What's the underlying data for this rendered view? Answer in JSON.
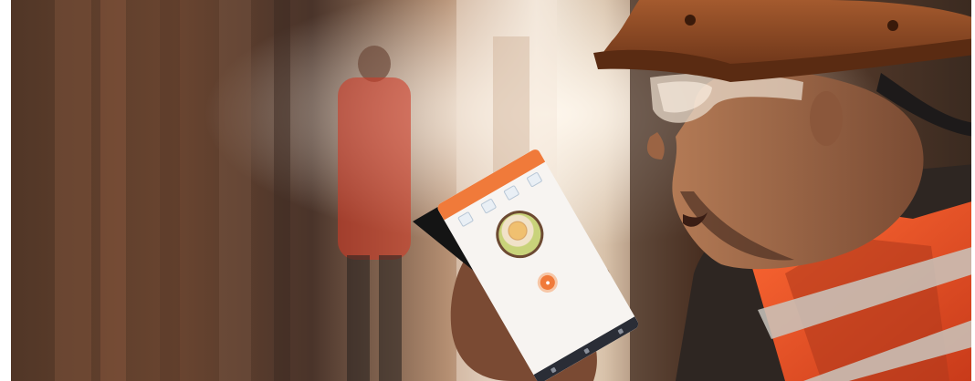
{
  "scene": {
    "colors": {
      "background_warm": "#5b3b28",
      "hard_hat": "#8b4a25",
      "safety_vest": "#f05a2a",
      "phone_accent": "#f07a3a"
    }
  },
  "phone": {
    "header_text": "",
    "greeting": "",
    "subgreeting": "",
    "mic_icon": "microphone-icon",
    "nav_icons": [
      "back-icon",
      "home-icon",
      "recents-icon"
    ]
  }
}
